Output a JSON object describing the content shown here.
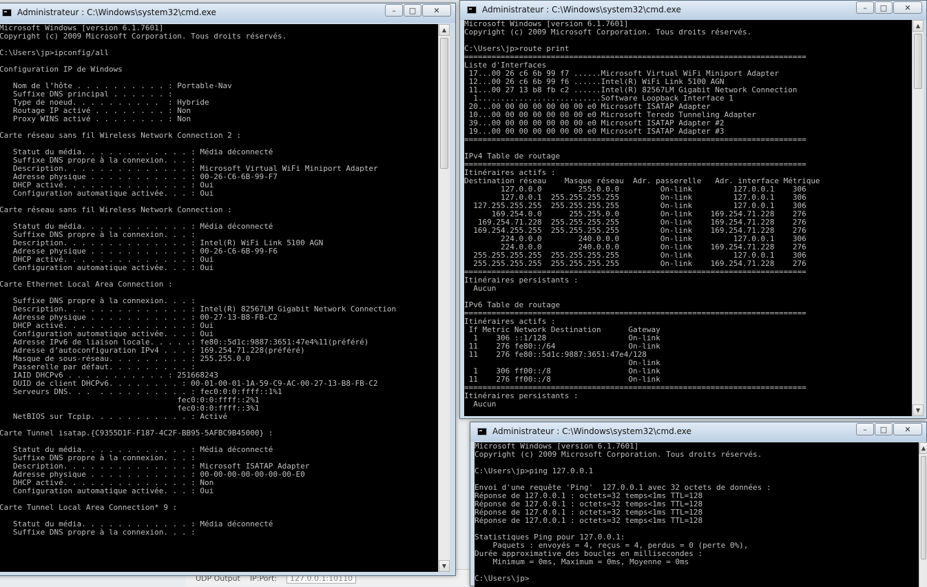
{
  "background": {
    "udp_output_label": "UDP Output",
    "ip_port_label": "IP:Port:",
    "ip_port_value": "127.0.0.1:10110"
  },
  "windows": [
    {
      "title": "Administrateur : C:\\Windows\\system32\\cmd.exe",
      "command": "ipconfig/all",
      "text": "Microsoft Windows [version 6.1.7601]\nCopyright (c) 2009 Microsoft Corporation. Tous droits réservés.\n\nC:\\Users\\jp>ipconfig/all\n\nConfiguration IP de Windows\n\n   Nom de l’hôte . . . . . . . . . . : Portable-Nav\n   Suffixe DNS principal . . . . . . :\n   Type de noeud. . . . . . . . . .  : Hybride\n   Routage IP activé . . . . . . . . : Non\n   Proxy WINS activé . . . . . . . . : Non\n\nCarte réseau sans fil Wireless Network Connection 2 :\n\n   Statut du média. . . . . . . . . . . . : Média déconnecté\n   Suffixe DNS propre à la connexion. . . :\n   Description. . . . . . . . . . . . . . : Microsoft Virtual WiFi Miniport Adapter\n   Adresse physique . . . . . . . . . . . : 00-26-C6-6B-99-F7\n   DHCP activé. . . . . . . . . . . . . . : Oui\n   Configuration automatique activée. . . : Oui\n\nCarte réseau sans fil Wireless Network Connection :\n\n   Statut du média. . . . . . . . . . . . : Média déconnecté\n   Suffixe DNS propre à la connexion. . . :\n   Description. . . . . . . . . . . . . . : Intel(R) WiFi Link 5100 AGN\n   Adresse physique . . . . . . . . . . . : 00-26-C6-6B-99-F6\n   DHCP activé. . . . . . . . . . . . . . : Oui\n   Configuration automatique activée. . . : Oui\n\nCarte Ethernet Local Area Connection :\n\n   Suffixe DNS propre à la connexion. . . :\n   Description. . . . . . . . . . . . . . : Intel(R) 82567LM Gigabit Network Connection\n   Adresse physique . . . . . . . . . . . : 00-27-13-B8-FB-C2\n   DHCP activé. . . . . . . . . . . . . . : Oui\n   Configuration automatique activée. . . : Oui\n   Adresse IPv6 de liaison locale. . . . .: fe80::5d1c:9887:3651:47e4%11(préféré)\n   Adresse d’autoconfiguration IPv4 . . . : 169.254.71.228(préféré)\n   Masque de sous-réseau. . . . . . . . . : 255.255.0.0\n   Passerelle par défaut. . . . . . . . . :\n   IAID DHCPv6 . . . . . . . . . . . : 251668243\n   DUID de client DHCPv6. . . . . . . . : 00-01-00-01-1A-59-C9-AC-00-27-13-B8-FB-C2\n   Serveurs DNS. . .  . . . . . . . . . . : fec0:0:0:ffff::1%1\n                                       fec0:0:0:ffff::2%1\n                                       fec0:0:0:ffff::3%1\n   NetBIOS sur Tcpip. . . . . . . . . . . : Activé\n\nCarte Tunnel isatap.{C9355D1F-F187-4C2F-BB95-5AFBC9B45000} :\n\n   Statut du média. . . . . . . . . . . . : Média déconnecté\n   Suffixe DNS propre à la connexion. . . :\n   Description. . . . . . . . . . . . . . : Microsoft ISATAP Adapter\n   Adresse physique . . . . . . . . . . . : 00-00-00-00-00-00-00-E0\n   DHCP activé. . . . . . . . . . . . . . : Non\n   Configuration automatique activée. . . : Oui\n\nCarte Tunnel Local Area Connection* 9 :\n\n   Statut du média. . . . . . . . . . . . : Média déconnecté\n   Suffixe DNS propre à la connexion. . . :"
    },
    {
      "title": "Administrateur : C:\\Windows\\system32\\cmd.exe",
      "command": "route print",
      "text": "Microsoft Windows [version 6.1.7601]\nCopyright (c) 2009 Microsoft Corporation. Tous droits réservés.\n\nC:\\Users\\jp>route print\n===========================================================================\nListe d'Interfaces\n 17...00 26 c6 6b 99 f7 ......Microsoft Virtual WiFi Miniport Adapter\n 12...00 26 c6 6b 99 f6 ......Intel(R) WiFi Link 5100 AGN\n 11...00 27 13 b8 fb c2 ......Intel(R) 82567LM Gigabit Network Connection\n  1...........................Software Loopback Interface 1\n 20...00 00 00 00 00 00 00 e0 Microsoft ISATAP Adapter\n 10...00 00 00 00 00 00 00 e0 Microsoft Teredo Tunneling Adapter\n 39...00 00 00 00 00 00 00 e0 Microsoft ISATAP Adapter #2\n 19...00 00 00 00 00 00 00 e0 Microsoft ISATAP Adapter #3\n===========================================================================\n\nIPv4 Table de routage\n===========================================================================\nItinéraires actifs :\nDestination réseau    Masque réseau  Adr. passerelle   Adr. interface Métrique\n        127.0.0.0        255.0.0.0         On-link         127.0.0.1    306\n        127.0.0.1  255.255.255.255         On-link         127.0.0.1    306\n  127.255.255.255  255.255.255.255         On-link         127.0.0.1    306\n      169.254.0.0      255.255.0.0         On-link    169.254.71.228    276\n   169.254.71.228  255.255.255.255         On-link    169.254.71.228    276\n  169.254.255.255  255.255.255.255         On-link    169.254.71.228    276\n        224.0.0.0        240.0.0.0         On-link         127.0.0.1    306\n        224.0.0.0        240.0.0.0         On-link    169.254.71.228    276\n  255.255.255.255  255.255.255.255         On-link         127.0.0.1    306\n  255.255.255.255  255.255.255.255         On-link    169.254.71.228    276\n===========================================================================\nItinéraires persistants :\n  Aucun\n\nIPv6 Table de routage\n===========================================================================\nItinéraires actifs :\n If Metric Network Destination      Gateway\n  1    306 ::1/128                  On-link\n 11    276 fe80::/64                On-link\n 11    276 fe80::5d1c:9887:3651:47e4/128\n                                    On-link\n  1    306 ff00::/8                 On-link\n 11    276 ff00::/8                 On-link\n===========================================================================\nItinéraires persistants :\n  Aucun"
    },
    {
      "title": "Administrateur : C:\\Windows\\system32\\cmd.exe",
      "command": "ping 127.0.0.1",
      "text": "Microsoft Windows [version 6.1.7601]\nCopyright (c) 2009 Microsoft Corporation. Tous droits réservés.\n\nC:\\Users\\jp>ping 127.0.0.1\n\nEnvoi d'une requête 'Ping'  127.0.0.1 avec 32 octets de données :\nRéponse de 127.0.0.1 : octets=32 temps<1ms TTL=128\nRéponse de 127.0.0.1 : octets=32 temps<1ms TTL=128\nRéponse de 127.0.0.1 : octets=32 temps<1ms TTL=128\nRéponse de 127.0.0.1 : octets=32 temps<1ms TTL=128\n\nStatistiques Ping pour 127.0.0.1:\n    Paquets : envoyés = 4, reçus = 4, perdus = 0 (perte 0%),\nDurée approximative des boucles en millisecondes :\n    Minimum = 0ms, Maximum = 0ms, Moyenne = 0ms\n\nC:\\Users\\jp>"
    }
  ]
}
